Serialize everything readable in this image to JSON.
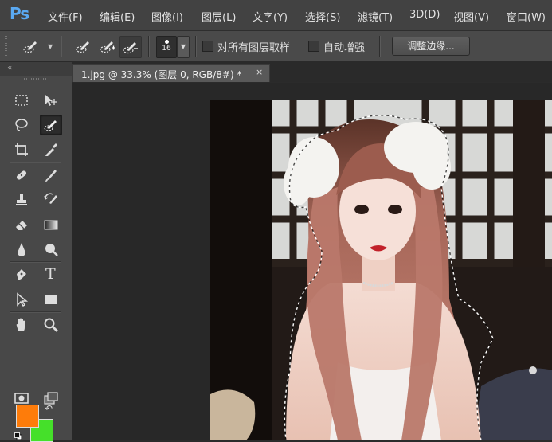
{
  "app": {
    "logo": "Ps"
  },
  "menu": [
    {
      "label": "文件(F)"
    },
    {
      "label": "编辑(E)"
    },
    {
      "label": "图像(I)"
    },
    {
      "label": "图层(L)"
    },
    {
      "label": "文字(Y)"
    },
    {
      "label": "选择(S)"
    },
    {
      "label": "滤镜(T)"
    },
    {
      "label": "3D(D)"
    },
    {
      "label": "视图(V)"
    },
    {
      "label": "窗口(W)"
    }
  ],
  "options": {
    "brush_size": "16",
    "sample_all_layers_label": "对所有图层取样",
    "sample_all_layers_checked": false,
    "auto_enhance_label": "自动增强",
    "auto_enhance_checked": false,
    "refine_edge_label": "调整边缘..."
  },
  "toolbox": {
    "collapse_glyph": "«",
    "active_tool": "quick-selection-tool",
    "foreground_color": "#fe7c0a",
    "background_color": "#45e02a",
    "type_tool_glyph": "T"
  },
  "document_tab": {
    "title": "1.jpg @ 33.3% (图层 0, RGB/8#) *",
    "close_glyph": "×"
  },
  "canvas": {
    "has_selection": true
  }
}
